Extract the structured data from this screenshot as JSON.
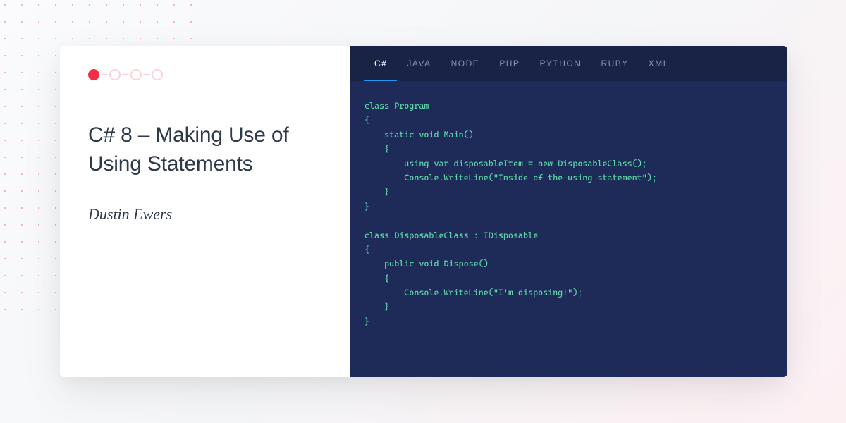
{
  "title": "C# 8 – Making Use of Using Statements",
  "author": "Dustin Ewers",
  "tabs": [
    {
      "label": "C#",
      "active": true
    },
    {
      "label": "JAVA",
      "active": false
    },
    {
      "label": "NODE",
      "active": false
    },
    {
      "label": "PHP",
      "active": false
    },
    {
      "label": "PYTHON",
      "active": false
    },
    {
      "label": "RUBY",
      "active": false
    },
    {
      "label": "XML",
      "active": false
    }
  ],
  "code": "class Program\n{\n    static void Main()\n    {\n        using var disposableItem = new DisposableClass();\n        Console.WriteLine(\"Inside of the using statement\");\n    }\n}\n\nclass DisposableClass : IDisposable\n{\n    public void Dispose()\n    {\n        Console.WriteLine(\"I'm disposing!\");\n    }\n}",
  "colors": {
    "accent_red": "#f22f46",
    "code_bg": "#1e2b58",
    "tab_bg": "#182346",
    "tab_active_underline": "#2196f3",
    "code_green": "#5fd4a8",
    "dot_pink": "#f29ca8"
  },
  "steps": {
    "total": 4,
    "current": 1
  }
}
